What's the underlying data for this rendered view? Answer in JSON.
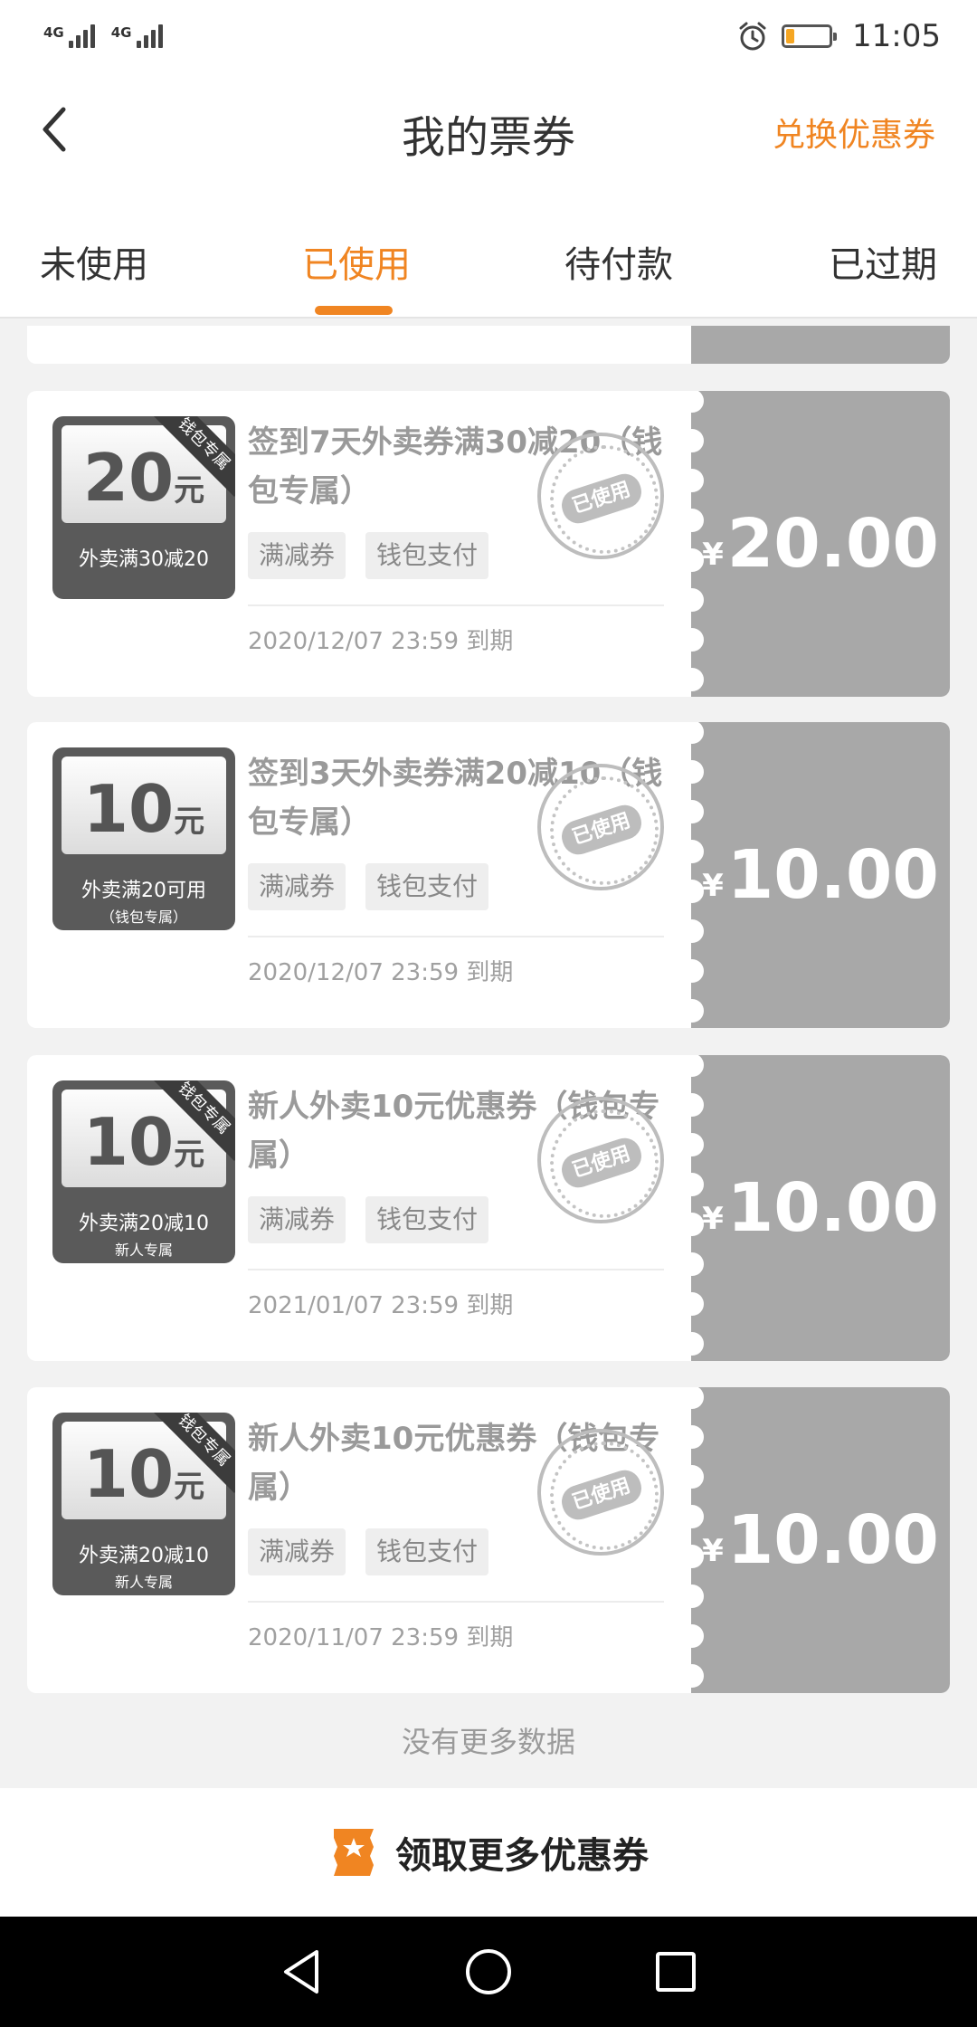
{
  "status": {
    "network1": "4G",
    "network2": "4G",
    "time": "11:05",
    "battery_level": 0.2
  },
  "header": {
    "title": "我的票券",
    "exchange": "兑换优惠券"
  },
  "tabs": [
    {
      "label": "未使用",
      "active": false
    },
    {
      "label": "已使用",
      "active": true
    },
    {
      "label": "待付款",
      "active": false
    },
    {
      "label": "已过期",
      "active": false
    }
  ],
  "coupons": [
    {
      "thumb_amount": "20",
      "thumb_unit": "元",
      "thumb_ribbon": "钱包专属",
      "thumb_sub": "外卖满30减20",
      "thumb_sub2": "",
      "title": "签到7天外卖券满30减20（钱包专属）",
      "tags": [
        "满减券",
        "钱包支付"
      ],
      "stamp": "已使用",
      "expire": "2020/12/07 23:59 到期",
      "currency": "¥",
      "value": "20.00"
    },
    {
      "thumb_amount": "10",
      "thumb_unit": "元",
      "thumb_ribbon": "",
      "thumb_sub": "外卖满20可用",
      "thumb_sub2": "（钱包专属）",
      "title": "签到3天外卖券满20减10（钱包专属）",
      "tags": [
        "满减券",
        "钱包支付"
      ],
      "stamp": "已使用",
      "expire": "2020/12/07 23:59 到期",
      "currency": "¥",
      "value": "10.00"
    },
    {
      "thumb_amount": "10",
      "thumb_unit": "元",
      "thumb_ribbon": "钱包专属",
      "thumb_sub": "外卖满20减10",
      "thumb_sub2": "新人专属",
      "title": "新人外卖10元优惠券（钱包专属）",
      "tags": [
        "满减券",
        "钱包支付"
      ],
      "stamp": "已使用",
      "expire": "2021/01/07 23:59 到期",
      "currency": "¥",
      "value": "10.00"
    },
    {
      "thumb_amount": "10",
      "thumb_unit": "元",
      "thumb_ribbon": "钱包专属",
      "thumb_sub": "外卖满20减10",
      "thumb_sub2": "新人专属",
      "title": "新人外卖10元优惠券（钱包专属）",
      "tags": [
        "满减券",
        "钱包支付"
      ],
      "stamp": "已使用",
      "expire": "2020/11/07 23:59 到期",
      "currency": "¥",
      "value": "10.00"
    }
  ],
  "footer_note": "没有更多数据",
  "bottom_action": {
    "label": "领取更多优惠券",
    "icon": "ticket-star-icon"
  },
  "colors": {
    "accent": "#f08522",
    "used_gray": "#a8a8a8"
  }
}
